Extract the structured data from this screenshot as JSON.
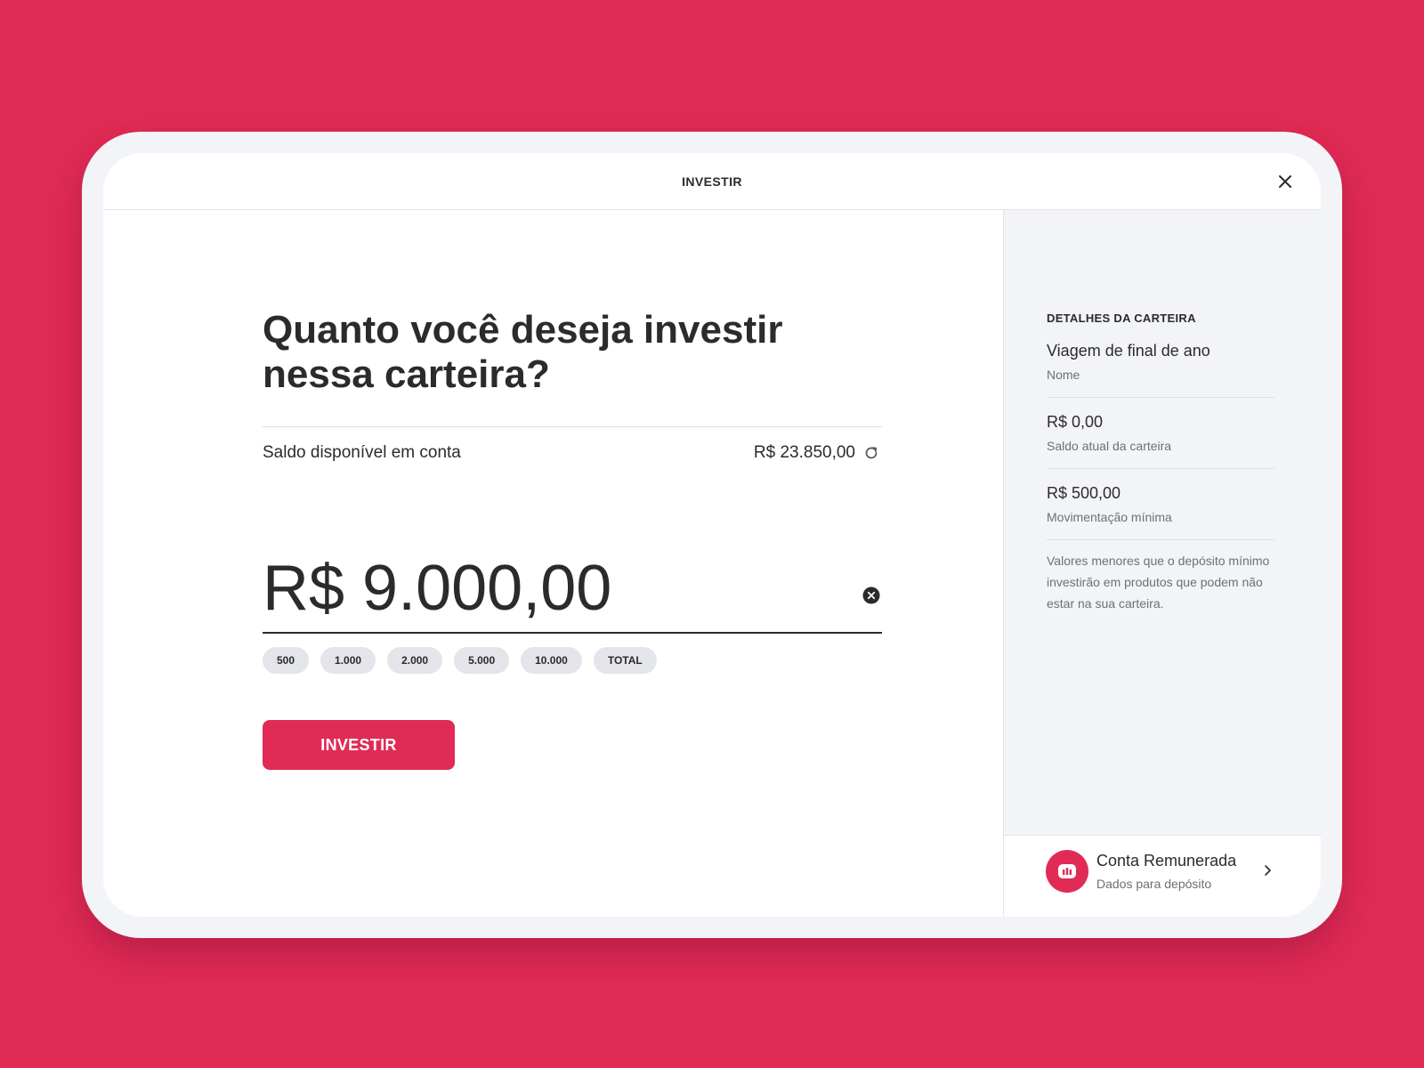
{
  "header": {
    "title": "INVESTIR",
    "close_icon": "close-icon"
  },
  "main": {
    "question": "Quanto você deseja investir nessa carteira?",
    "balance_label": "Saldo disponível em conta",
    "balance_value": "R$ 23.850,00",
    "refresh_icon": "refresh-icon",
    "amount_value": "R$ 9.000,00",
    "clear_icon": "clear-circle-icon",
    "chips": [
      "500",
      "1.000",
      "2.000",
      "5.000",
      "10.000",
      "TOTAL"
    ],
    "invest_label": "INVESTIR"
  },
  "sidebar": {
    "heading": "DETALHES DA CARTEIRA",
    "details": [
      {
        "value": "Viagem de final de ano",
        "label": "Nome"
      },
      {
        "value": "R$ 0,00",
        "label": "Saldo atual da carteira"
      },
      {
        "value": "R$ 500,00",
        "label": "Movimentação mínima"
      }
    ],
    "note": "Valores menores que o depósito mínimo investirão em produtos que podem não estar na sua carteira.",
    "account": {
      "title": "Conta Remunerada",
      "subtitle": "Dados para depósito",
      "icon": "bar-chart-icon",
      "chevron": "chevron-right-icon"
    }
  },
  "colors": {
    "brand": "#e02b55",
    "text": "#2b2b2b",
    "muted": "#6e6f78",
    "panel": "#f3f4f8"
  }
}
